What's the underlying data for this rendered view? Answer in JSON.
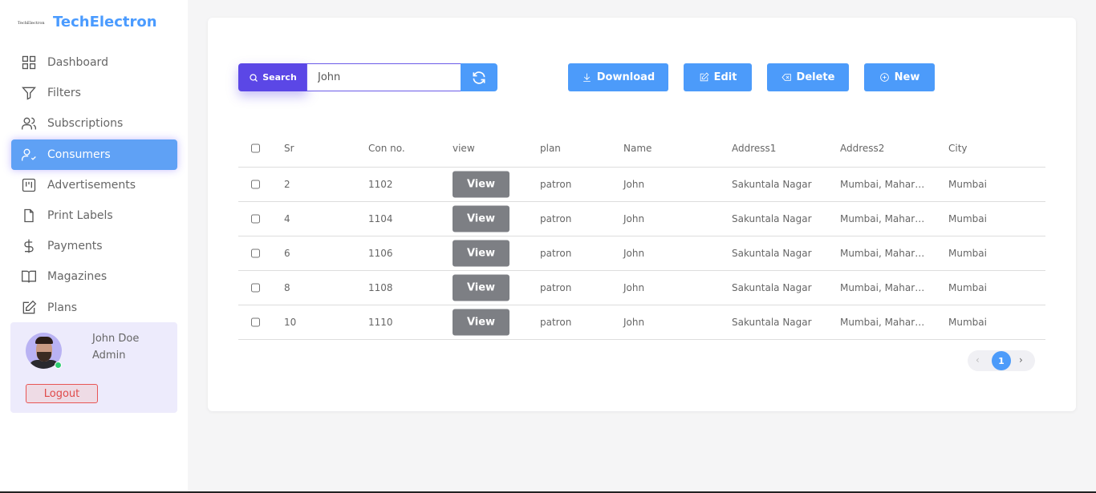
{
  "brand": {
    "logo_text": "TechElectron",
    "title": "TechElectron"
  },
  "sidebar": {
    "items": [
      {
        "label": "Dashboard",
        "icon": "grid-icon"
      },
      {
        "label": "Filters",
        "icon": "filter-icon"
      },
      {
        "label": "Subscriptions",
        "icon": "users-icon"
      },
      {
        "label": "Consumers",
        "icon": "user-check-icon",
        "active": true
      },
      {
        "label": "Advertisements",
        "icon": "board-icon"
      },
      {
        "label": "Print Labels",
        "icon": "file-icon"
      },
      {
        "label": "Payments",
        "icon": "dollar-icon"
      },
      {
        "label": "Magazines",
        "icon": "book-icon"
      },
      {
        "label": "Plans",
        "icon": "edit-icon"
      }
    ]
  },
  "user": {
    "name": "John Doe",
    "role": "Admin",
    "logout": "Logout",
    "status_color": "#2ecc71"
  },
  "toolbar": {
    "search_label": "Search",
    "search_value": "John",
    "download": "Download",
    "edit": "Edit",
    "delete": "Delete",
    "new": "New"
  },
  "table": {
    "headers": [
      "Sr",
      "Con no.",
      "view",
      "plan",
      "Name",
      "Address1",
      "Address2",
      "City"
    ],
    "rows": [
      {
        "sr": "2",
        "con": "1102",
        "view": "View",
        "plan": "patron",
        "name": "John",
        "address1": "Sakuntala Nagar",
        "address2": "Mumbai, Maharashtra",
        "city": "Mumbai"
      },
      {
        "sr": "4",
        "con": "1104",
        "view": "View",
        "plan": "patron",
        "name": "John",
        "address1": "Sakuntala Nagar",
        "address2": "Mumbai, Maharashtra",
        "city": "Mumbai"
      },
      {
        "sr": "6",
        "con": "1106",
        "view": "View",
        "plan": "patron",
        "name": "John",
        "address1": "Sakuntala Nagar",
        "address2": "Mumbai, Maharashtra",
        "city": "Mumbai"
      },
      {
        "sr": "8",
        "con": "1108",
        "view": "View",
        "plan": "patron",
        "name": "John",
        "address1": "Sakuntala Nagar",
        "address2": "Mumbai, Maharashtra",
        "city": "Mumbai"
      },
      {
        "sr": "10",
        "con": "1110",
        "view": "View",
        "plan": "patron",
        "name": "John",
        "address1": "Sakuntala Nagar",
        "address2": "Mumbai, Maharashtra",
        "city": "Mumbai"
      }
    ]
  },
  "pagination": {
    "current": "1",
    "prev": "‹",
    "next": "›"
  },
  "colors": {
    "accent": "#4c9bfa",
    "search": "#5b47e6",
    "view_button": "#7d7f84"
  }
}
